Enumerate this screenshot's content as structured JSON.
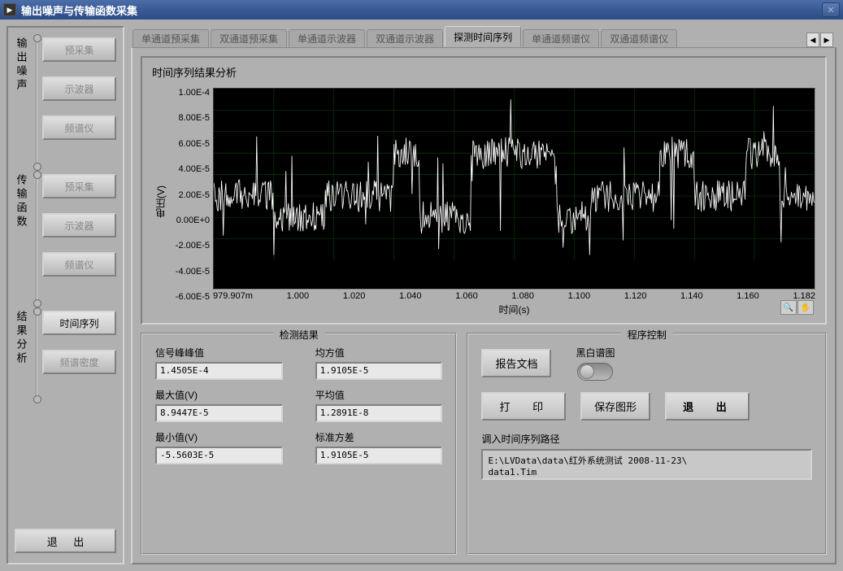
{
  "window_title": "输出噪声与传输函数采集",
  "sidebar": {
    "groups": [
      {
        "label": "输出噪声",
        "buttons": [
          "预采集",
          "示波器",
          "频谱仪"
        ]
      },
      {
        "label": "传输函数",
        "buttons": [
          "预采集",
          "示波器",
          "频谱仪"
        ]
      },
      {
        "label": "结果分析",
        "buttons": [
          "时间序列",
          "频谱密度"
        ]
      }
    ],
    "exit": "退   出"
  },
  "tabs": [
    "单通道预采集",
    "双通道预采集",
    "单通道示波器",
    "双通道示波器",
    "探测时间序列",
    "单通道频谱仪",
    "双通道频谱仪"
  ],
  "active_tab": 4,
  "chart": {
    "title": "时间序列结果分析",
    "ylabel": "电压(V)",
    "xlabel": "时间(s)",
    "yticks": [
      "1.00E-4",
      "8.00E-5",
      "6.00E-5",
      "4.00E-5",
      "2.00E-5",
      "0.00E+0",
      "-2.00E-5",
      "-4.00E-5",
      "-6.00E-5"
    ],
    "xticks": [
      "979.907m",
      "1.000",
      "1.020",
      "1.040",
      "1.060",
      "1.080",
      "1.100",
      "1.120",
      "1.140",
      "1.160",
      "1.182"
    ]
  },
  "results": {
    "legend": "检测结果",
    "items": [
      {
        "label": "信号峰峰值",
        "value": "1.4505E-4"
      },
      {
        "label": "均方值",
        "value": "1.9105E-5"
      },
      {
        "label": "最大值(V)",
        "value": "8.9447E-5"
      },
      {
        "label": "平均值",
        "value": "1.2891E-8"
      },
      {
        "label": "最小值(V)",
        "value": "-5.5603E-5"
      },
      {
        "label": "标准方差",
        "value": "1.9105E-5"
      }
    ]
  },
  "control": {
    "legend": "程序控制",
    "report": "报告文档",
    "bw_label": "黑白谱图",
    "print": "打    印",
    "save": "保存图形",
    "exit": "退    出",
    "path_label": "调入时间序列路径",
    "path_value": "E:\\LVData\\data\\红外系统测试 2008-11-23\\\ndata1.Tim"
  },
  "chart_data": {
    "type": "line",
    "title": "时间序列结果分析",
    "xlabel": "时间(s)",
    "ylabel": "电压(V)",
    "xlim": [
      0.979907,
      1.182
    ],
    "ylim": [
      -6e-05,
      0.0001
    ],
    "note": "Dense noisy time series with rectangular-pulse-like baseline shifts between about -2e-5 and +4e-5 with spikes up to ~9e-5 and down to ~-5.5e-5",
    "stats": {
      "peak_to_peak": 0.00014505,
      "rms": 1.9105e-05,
      "max": 8.9447e-05,
      "mean": 1.2891e-08,
      "min": -5.5603e-05,
      "std": 1.9105e-05
    }
  }
}
